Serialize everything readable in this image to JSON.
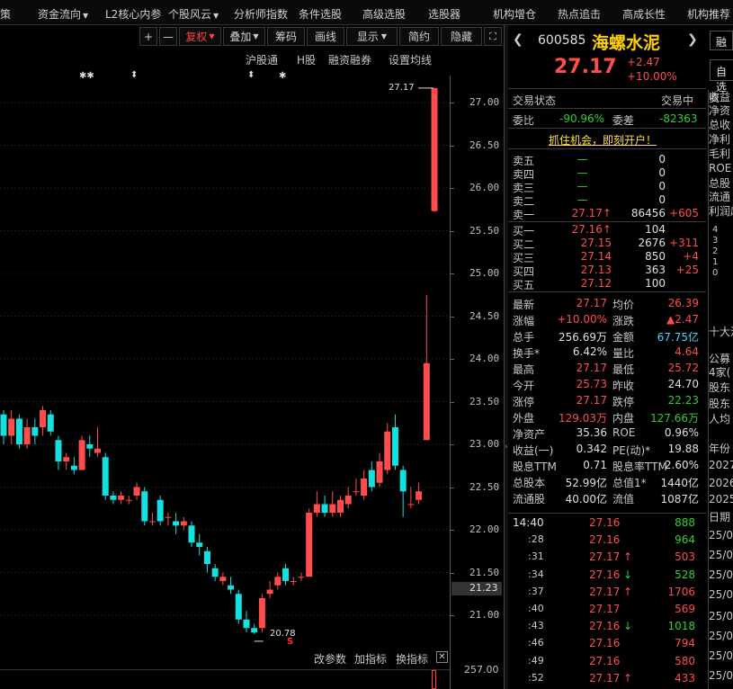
{
  "menu": [
    "策",
    "资金流向",
    "L2核心内参",
    "个股风云",
    "分析师指数",
    "条件选股",
    "高级选股",
    "选股器",
    "机构增仓",
    "热点追击",
    "高成长性",
    "机构推荐"
  ],
  "toolbar": {
    "plus": "+",
    "minus": "—",
    "fuquan": "复权",
    "diejia": "叠加",
    "chouma": "筹码",
    "huaxian": "画线",
    "xianshi": "显示",
    "jianyue": "简约",
    "yincang": "隐藏",
    "expand": "⛶"
  },
  "chart_labels": {
    "hgt": "沪股通",
    "h": "H股",
    "rzrq": "融资融券",
    "setma": "设置均线",
    "star1": "✱✱",
    "mark1": "⬍",
    "mark2": "⬍",
    "star2": "✱",
    "high": "27.17",
    "low": "20.78",
    "s_mark": "S",
    "cur_price": "21.23",
    "vol_max": "257.00"
  },
  "yaxis": [
    "27.00",
    "26.50",
    "26.00",
    "25.50",
    "25.00",
    "24.50",
    "24.00",
    "23.50",
    "23.00",
    "22.50",
    "22.00",
    "21.50",
    "21.00"
  ],
  "ind_bar": {
    "a": "改参数",
    "b": "加指标",
    "c": "换指标"
  },
  "stock": {
    "code": "600585",
    "name": "海螺水泥",
    "price": "27.17",
    "change": "+2.47",
    "pct": "+10.00%",
    "btn1": "融",
    "btn2": "自选"
  },
  "status": {
    "label": "交易状态",
    "value": "交易中"
  },
  "weibi": {
    "l1": "委比",
    "v1": "-90.96%",
    "l2": "委差",
    "v2": "-82363"
  },
  "promo": "抓住机会，即刻开户！",
  "sells": [
    {
      "l": "卖五",
      "p": "—",
      "v": "0",
      "d": ""
    },
    {
      "l": "卖四",
      "p": "—",
      "v": "0",
      "d": ""
    },
    {
      "l": "卖三",
      "p": "—",
      "v": "0",
      "d": ""
    },
    {
      "l": "卖二",
      "p": "—",
      "v": "0",
      "d": ""
    },
    {
      "l": "卖一",
      "p": "27.17",
      "a": "↑",
      "v": "86456",
      "d": "+605"
    }
  ],
  "buys": [
    {
      "l": "买一",
      "p": "27.16",
      "a": "↑",
      "v": "104",
      "d": ""
    },
    {
      "l": "买二",
      "p": "27.15",
      "a": "",
      "v": "2676",
      "d": "+311"
    },
    {
      "l": "买三",
      "p": "27.14",
      "a": "",
      "v": "850",
      "d": "+4"
    },
    {
      "l": "买四",
      "p": "27.13",
      "a": "",
      "v": "363",
      "d": "+25"
    },
    {
      "l": "买五",
      "p": "27.12",
      "a": "",
      "v": "100",
      "d": ""
    }
  ],
  "stats": [
    {
      "l1": "最新",
      "v1": "27.17",
      "c1": "r",
      "l2": "均价",
      "v2": "26.39",
      "c2": "r"
    },
    {
      "l1": "涨幅",
      "v1": "+10.00%",
      "c1": "r",
      "l2": "涨跌",
      "v2": "▲2.47",
      "c2": "r"
    },
    {
      "l1": "总手",
      "v1": "256.69万",
      "c1": "w",
      "l2": "金额",
      "v2": "67.75亿",
      "c2": "c"
    },
    {
      "l1": "换手*",
      "v1": "6.42%",
      "c1": "w",
      "l2": "量比",
      "v2": "4.64",
      "c2": "r"
    },
    {
      "l1": "最高",
      "v1": "27.17",
      "c1": "r",
      "l2": "最低",
      "v2": "25.72",
      "c2": "r"
    },
    {
      "l1": "今开",
      "v1": "25.73",
      "c1": "r",
      "l2": "昨收",
      "v2": "24.70",
      "c2": "w"
    },
    {
      "l1": "涨停",
      "v1": "27.17",
      "c1": "r",
      "l2": "跌停",
      "v2": "22.23",
      "c2": "g"
    },
    {
      "l1": "外盘",
      "v1": "129.03万",
      "c1": "r",
      "l2": "内盘",
      "v2": "127.66万",
      "c2": "g"
    },
    {
      "l1": "净资产",
      "v1": "35.36",
      "c1": "w",
      "l2": "ROE",
      "v2": "0.96%",
      "c2": "w"
    },
    {
      "l1": "收益(一)",
      "v1": "0.342",
      "c1": "w",
      "l2": "PE(动)*",
      "v2": "19.88",
      "c2": "w"
    },
    {
      "l1": "股息TTM",
      "v1": "0.71",
      "c1": "w",
      "l2": "股息率TTM",
      "v2": "2.60%",
      "c2": "w"
    },
    {
      "l1": "总股本",
      "v1": "52.99亿",
      "c1": "w",
      "l2": "总值1*",
      "v2": "1440亿",
      "c2": "w"
    },
    {
      "l1": "流通股",
      "v1": "40.00亿",
      "c1": "w",
      "l2": "流值",
      "v2": "1087亿",
      "c2": "w"
    }
  ],
  "ticks": [
    {
      "t": "14:40",
      "p": "27.16",
      "a": "",
      "v": "888",
      "vc": "g"
    },
    {
      "t": ":28",
      "p": "27.16",
      "a": "",
      "v": "964",
      "vc": "g"
    },
    {
      "t": ":31",
      "p": "27.17",
      "a": "↑",
      "v": "503",
      "vc": "r"
    },
    {
      "t": ":34",
      "p": "27.16",
      "a": "↓",
      "v": "528",
      "vc": "g"
    },
    {
      "t": ":37",
      "p": "27.17",
      "a": "↑",
      "v": "1706",
      "vc": "r"
    },
    {
      "t": ":40",
      "p": "27.17",
      "a": "",
      "v": "569",
      "vc": "r"
    },
    {
      "t": ":43",
      "p": "27.16",
      "a": "↓",
      "v": "1018",
      "vc": "g"
    },
    {
      "t": ":46",
      "p": "27.16",
      "a": "",
      "v": "794",
      "vc": "r"
    },
    {
      "t": ":49",
      "p": "27.16",
      "a": "",
      "v": "580",
      "vc": "r"
    },
    {
      "t": ":52",
      "p": "27.17",
      "a": "↑",
      "v": "433",
      "vc": "r"
    }
  ],
  "far": [
    "资",
    "收益",
    "净资",
    "总收",
    "净利",
    "毛利",
    "ROE",
    "总股",
    "流通",
    "利润趋",
    "4",
    "3",
    "2",
    "1",
    "0",
    "十大流",
    "公募",
    "4家(",
    "股东",
    "股东",
    "人均",
    "年份",
    "2027",
    "2026",
    "2025",
    "日期",
    "25/0",
    "25/0",
    "25/0",
    "25/0",
    "25/0",
    "25/0",
    "25/0",
    "25/0",
    "25/0"
  ],
  "candles": [
    {
      "o": 23.35,
      "c": 23.1,
      "h": 23.4,
      "l": 23.0
    },
    {
      "o": 23.1,
      "c": 23.3,
      "h": 23.4,
      "l": 23.0
    },
    {
      "o": 23.3,
      "c": 23.0,
      "h": 23.35,
      "l": 22.95
    },
    {
      "o": 23.0,
      "c": 23.2,
      "h": 23.3,
      "l": 22.95
    },
    {
      "o": 23.2,
      "c": 23.1,
      "h": 23.3,
      "l": 23.0
    },
    {
      "o": 23.2,
      "c": 23.4,
      "h": 23.45,
      "l": 23.1
    },
    {
      "o": 23.35,
      "c": 23.15,
      "h": 23.4,
      "l": 23.1
    },
    {
      "o": 23.05,
      "c": 22.8,
      "h": 23.1,
      "l": 22.7
    },
    {
      "o": 22.8,
      "c": 22.85,
      "h": 22.9,
      "l": 22.7
    },
    {
      "o": 22.75,
      "c": 22.7,
      "h": 22.85,
      "l": 22.65
    },
    {
      "o": 22.7,
      "c": 23.05,
      "h": 23.1,
      "l": 22.7
    },
    {
      "o": 23.0,
      "c": 22.95,
      "h": 23.1,
      "l": 22.85
    },
    {
      "o": 22.9,
      "c": 22.95,
      "h": 23.2,
      "l": 22.85
    },
    {
      "o": 22.85,
      "c": 22.4,
      "h": 22.9,
      "l": 22.35
    },
    {
      "o": 22.4,
      "c": 22.35,
      "h": 22.45,
      "l": 22.3
    },
    {
      "o": 22.35,
      "c": 22.4,
      "h": 22.45,
      "l": 22.3
    },
    {
      "o": 22.35,
      "c": 22.35,
      "h": 22.4,
      "l": 22.3
    },
    {
      "o": 22.4,
      "c": 22.5,
      "h": 22.55,
      "l": 22.35
    },
    {
      "o": 22.45,
      "c": 22.1,
      "h": 22.5,
      "l": 22.05
    },
    {
      "o": 22.1,
      "c": 22.1,
      "h": 22.2,
      "l": 22.05
    },
    {
      "o": 22.35,
      "c": 22.1,
      "h": 22.4,
      "l": 22.05
    },
    {
      "o": 22.15,
      "c": 22.15,
      "h": 22.2,
      "l": 22.05
    },
    {
      "o": 22.1,
      "c": 22.05,
      "h": 22.2,
      "l": 21.95
    },
    {
      "o": 22.05,
      "c": 22.1,
      "h": 22.15,
      "l": 22.0
    },
    {
      "o": 22.05,
      "c": 21.85,
      "h": 22.1,
      "l": 21.8
    },
    {
      "o": 21.85,
      "c": 21.8,
      "h": 21.95,
      "l": 21.7
    },
    {
      "o": 21.75,
      "c": 21.6,
      "h": 21.8,
      "l": 21.5
    },
    {
      "o": 21.55,
      "c": 21.45,
      "h": 21.6,
      "l": 21.4
    },
    {
      "o": 21.4,
      "c": 21.45,
      "h": 21.5,
      "l": 21.35
    },
    {
      "o": 21.35,
      "c": 21.3,
      "h": 21.45,
      "l": 21.25
    },
    {
      "o": 21.25,
      "c": 20.95,
      "h": 21.3,
      "l": 20.9
    },
    {
      "o": 20.95,
      "c": 20.85,
      "h": 21.05,
      "l": 20.8
    },
    {
      "o": 20.85,
      "c": 20.8,
      "h": 20.9,
      "l": 20.78
    },
    {
      "o": 20.85,
      "c": 21.2,
      "h": 21.25,
      "l": 20.8
    },
    {
      "o": 21.25,
      "c": 21.3,
      "h": 21.4,
      "l": 21.2
    },
    {
      "o": 21.35,
      "c": 21.45,
      "h": 21.5,
      "l": 21.3
    },
    {
      "o": 21.55,
      "c": 21.4,
      "h": 21.6,
      "l": 21.35
    },
    {
      "o": 21.4,
      "c": 21.4,
      "h": 21.45,
      "l": 21.35
    },
    {
      "o": 21.45,
      "c": 21.45,
      "h": 21.5,
      "l": 21.4
    },
    {
      "o": 21.45,
      "c": 22.2,
      "h": 22.25,
      "l": 21.45
    },
    {
      "o": 22.2,
      "c": 22.3,
      "h": 22.45,
      "l": 22.15
    },
    {
      "o": 22.3,
      "c": 22.2,
      "h": 22.4,
      "l": 22.15
    },
    {
      "o": 22.2,
      "c": 22.3,
      "h": 22.45,
      "l": 22.15
    },
    {
      "o": 22.2,
      "c": 22.35,
      "h": 22.4,
      "l": 22.15
    },
    {
      "o": 22.3,
      "c": 22.4,
      "h": 22.5,
      "l": 22.25
    },
    {
      "o": 22.45,
      "c": 22.45,
      "h": 22.6,
      "l": 22.4
    },
    {
      "o": 22.4,
      "c": 22.6,
      "h": 22.7,
      "l": 22.35
    },
    {
      "o": 22.7,
      "c": 22.5,
      "h": 22.8,
      "l": 22.45
    },
    {
      "o": 22.55,
      "c": 22.8,
      "h": 22.9,
      "l": 22.5
    },
    {
      "o": 22.7,
      "c": 23.15,
      "h": 23.25,
      "l": 22.65
    },
    {
      "o": 23.2,
      "c": 22.75,
      "h": 23.35,
      "l": 22.7
    },
    {
      "o": 22.7,
      "c": 22.45,
      "h": 22.75,
      "l": 22.15
    },
    {
      "o": 22.3,
      "c": 22.3,
      "h": 22.5,
      "l": 22.25
    },
    {
      "o": 22.35,
      "c": 22.45,
      "h": 22.55,
      "l": 22.3
    },
    {
      "o": 23.05,
      "c": 23.95,
      "h": 24.75,
      "l": 23.05
    },
    {
      "o": 25.73,
      "c": 27.17,
      "h": 27.17,
      "l": 25.72
    }
  ]
}
